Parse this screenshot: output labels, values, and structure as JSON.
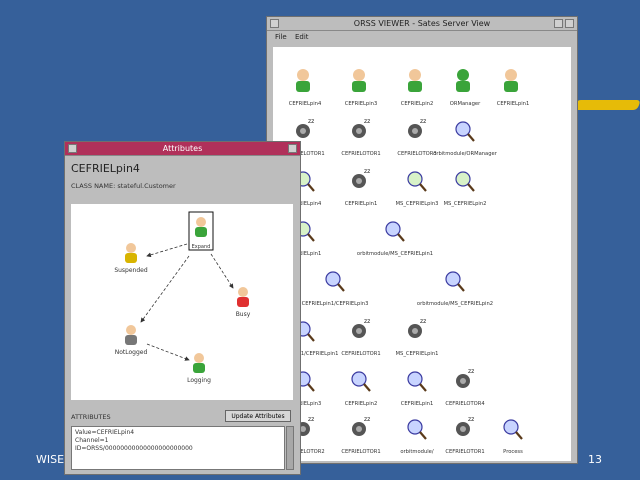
{
  "slide": {
    "footer_left": "WISE",
    "page_number": "13",
    "colors": {
      "background": "#36609a",
      "accent_stroke": "#f0c000"
    }
  },
  "viewer": {
    "title": "ORSS VIEWER - Sates Server View",
    "menu": [
      "File",
      "Edit"
    ],
    "rows": [
      [
        "CEFRIELpin4",
        "CEFRIELpin3",
        "CEFRIELpin2",
        "ORManager",
        "CEFRIELpin1"
      ],
      [
        "CEFRIELOTOR1",
        "CEFRIELOTOR1",
        "CEFRIELOTOR3",
        "orbitmodule/ORManager"
      ],
      [
        "CEFRIELpin4",
        "CEFRIELpin1",
        "MS_CEFRIELpin3",
        "MS_CEFRIELpin2"
      ],
      [
        "CEFRIELpin1",
        "orbitmodule/MS_CEFRIELpin1"
      ],
      [
        "CEFRIELpin1/CEFRIELpin3",
        "orbitmodule/MS_CEFRIELpin2"
      ],
      [
        "CEFRIELpin1/CEFRIELpin1",
        "CEFRIELOTOR1",
        "MS_CEFRIELpin1"
      ],
      [
        "CEFRIELpin3",
        "CEFRIELpin2",
        "CEFRIELpin1",
        "CEFRIELOTOR4"
      ],
      [
        "CEFRIELOTOR2",
        "CEFRIELOTOR1",
        "orbitmodule/",
        "CEFRIELOTOR1",
        "Process"
      ]
    ]
  },
  "attr": {
    "title": "Attributes",
    "object_name": "CEFRIELpin4",
    "class_line": "CLASS NAME: stateful.Customer",
    "states": {
      "current": "Expand",
      "left": "Suspended",
      "right": "Busy",
      "bottom_left": "NotLogged",
      "bottom": "Logging"
    },
    "attributes_label": "ATTRIBUTES",
    "update_button": "Update Attributes",
    "attribute_lines": [
      "Value=CEFRIELpin4",
      "Channel=1",
      "ID=ORSS/00000000000000000000000"
    ]
  }
}
